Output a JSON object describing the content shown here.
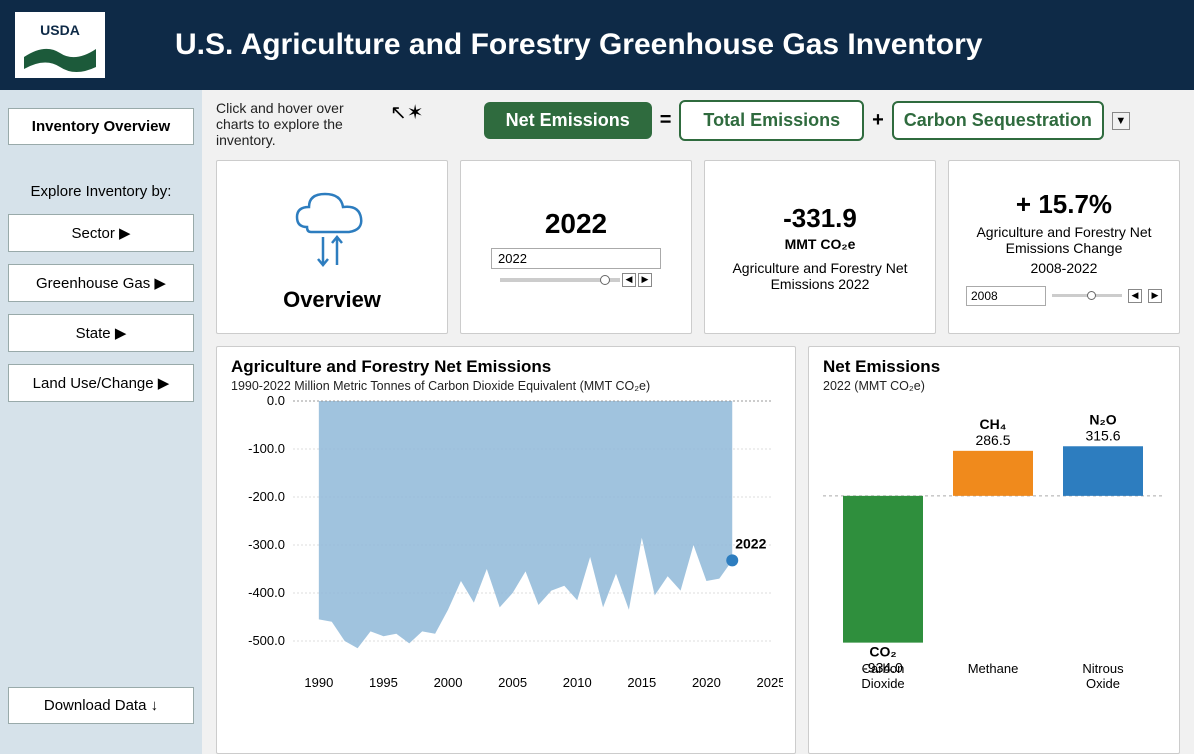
{
  "header": {
    "title": "U.S. Agriculture and Forestry Greenhouse Gas Inventory"
  },
  "sidebar": {
    "overview": "Inventory Overview",
    "explore_label": "Explore Inventory by:",
    "items": [
      "Sector ▶",
      "Greenhouse Gas ▶",
      "State ▶",
      "Land Use/Change ▶"
    ],
    "download": "Download Data ↓"
  },
  "instruction": "Click and hover over charts to explore the inventory.",
  "formula": {
    "net": "Net Emissions",
    "eq": "=",
    "total": "Total Emissions",
    "plus": "+",
    "seq": "Carbon Sequestration",
    "dd": "▼"
  },
  "cards": {
    "overview_label": "Overview",
    "year_big": "2022",
    "year_box": "2022",
    "net_value": "-331.9",
    "net_unit": "MMT CO₂e",
    "net_desc": "Agriculture and Forestry Net Emissions 2022",
    "change_value": "+ 15.7%",
    "change_desc1": "Agriculture and Forestry Net Emissions Change",
    "change_desc2": "2008-2022",
    "base_box": "2008"
  },
  "area_chart": {
    "title": "Agriculture and Forestry Net Emissions",
    "subtitle": "1990-2022 Million Metric Tonnes of Carbon Dioxide Equivalent (MMT CO₂e)",
    "label_last": "2022"
  },
  "bar_chart": {
    "title": "Net Emissions",
    "subtitle": "2022 (MMT CO₂e)"
  },
  "chart_data": [
    {
      "type": "area",
      "title": "Agriculture and Forestry Net Emissions",
      "xlabel": "",
      "ylabel": "MMT CO₂e",
      "ylim": [
        -550,
        0
      ],
      "x": [
        1990,
        1991,
        1992,
        1993,
        1994,
        1995,
        1996,
        1997,
        1998,
        1999,
        2000,
        2001,
        2002,
        2003,
        2004,
        2005,
        2006,
        2007,
        2008,
        2009,
        2010,
        2011,
        2012,
        2013,
        2014,
        2015,
        2016,
        2017,
        2018,
        2019,
        2020,
        2021,
        2022
      ],
      "values": [
        -455,
        -460,
        -500,
        -515,
        -480,
        -490,
        -485,
        -505,
        -480,
        -485,
        -435,
        -375,
        -420,
        -350,
        -430,
        -400,
        -355,
        -425,
        -395,
        -385,
        -415,
        -325,
        -430,
        -360,
        -435,
        -285,
        -405,
        -365,
        -395,
        -300,
        -375,
        -370,
        -332
      ],
      "annotations": [
        {
          "x": 2022,
          "y": -332,
          "text": "2022"
        }
      ]
    },
    {
      "type": "bar",
      "title": "Net Emissions 2022 (MMT CO₂e)",
      "categories": [
        "Carbon Dioxide",
        "Methane",
        "Nitrous Oxide"
      ],
      "series_labels": [
        "CO₂",
        "CH₄",
        "N₂O"
      ],
      "values": [
        -934.0,
        286.5,
        315.6
      ],
      "colors": [
        "#2f8f3d",
        "#f08a1c",
        "#2d7dbf"
      ],
      "ylim": [
        -1000,
        400
      ]
    }
  ]
}
